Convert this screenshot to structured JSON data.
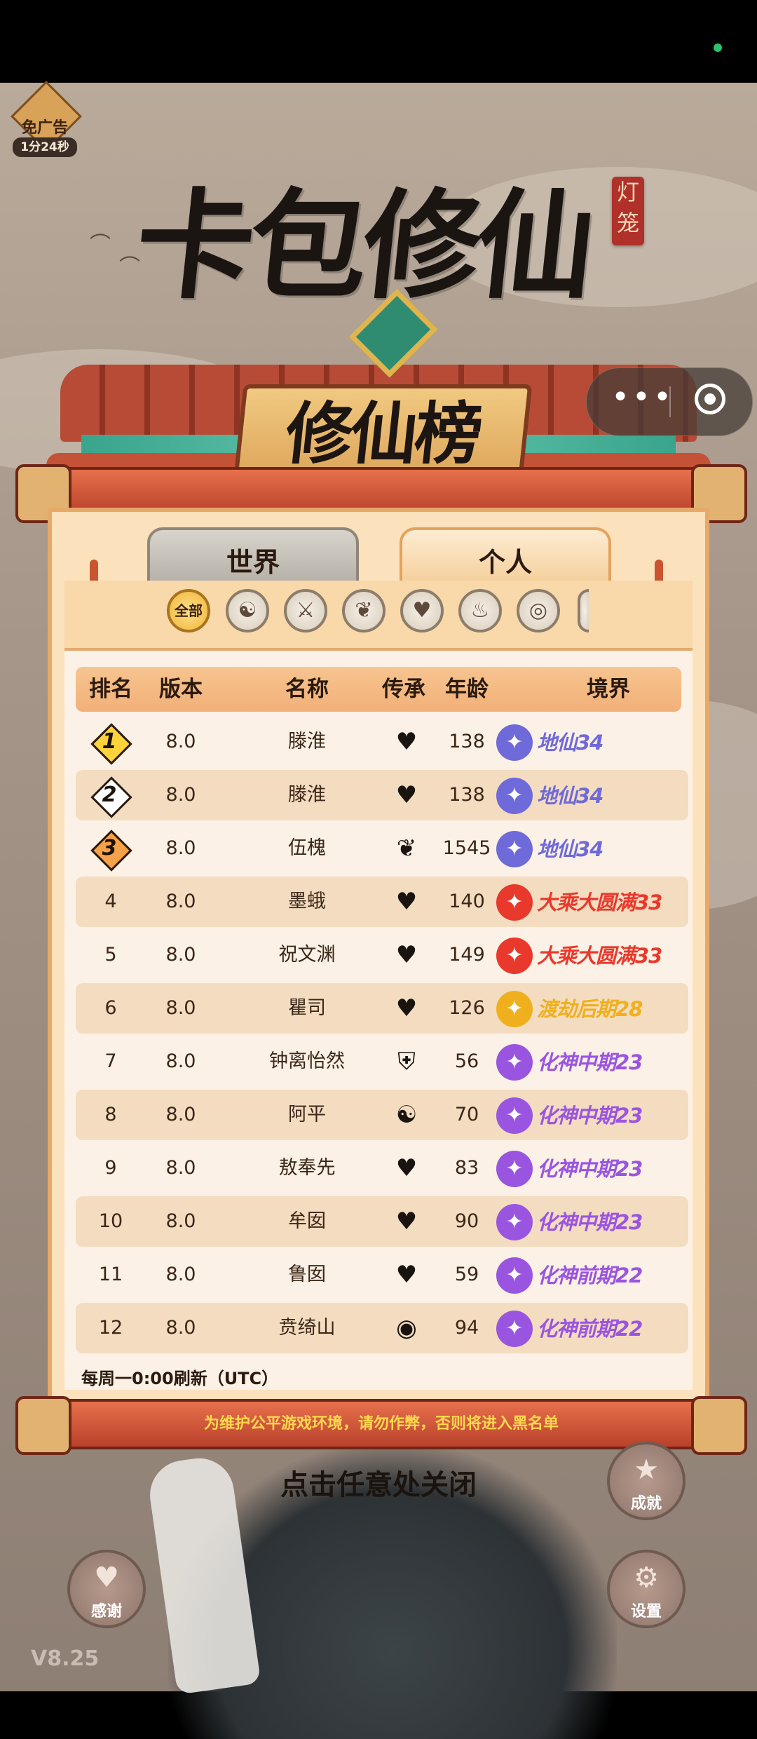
{
  "free_ad": {
    "label": "免广告",
    "timer": "1分24秒"
  },
  "seal": {
    "text": "灯笼"
  },
  "game_title": "卡包修仙",
  "board_title": "修仙榜",
  "capsule": {
    "more": "•••"
  },
  "tabs": {
    "world": "世界",
    "personal": "个人",
    "active": "personal"
  },
  "filters": [
    {
      "label": "全部",
      "active": true
    },
    {
      "icon": "yin-yang-icon"
    },
    {
      "icon": "sword-icon"
    },
    {
      "icon": "lotus-icon"
    },
    {
      "icon": "heart-icon"
    },
    {
      "icon": "flame-icon"
    },
    {
      "icon": "spiral-icon"
    }
  ],
  "table": {
    "headers": {
      "rank": "排名",
      "version": "版本",
      "name": "名称",
      "inherit": "传承",
      "age": "年龄",
      "realm": "境界"
    },
    "rows": [
      {
        "rank": "1",
        "version": "8.0",
        "name": "滕淮",
        "inherit_icon": "heart-icon",
        "age": "138",
        "realm": "地仙34",
        "realm_color": "#6f6ad9"
      },
      {
        "rank": "2",
        "version": "8.0",
        "name": "滕淮",
        "inherit_icon": "heart-icon",
        "age": "138",
        "realm": "地仙34",
        "realm_color": "#6f6ad9"
      },
      {
        "rank": "3",
        "version": "8.0",
        "name": "伍槐",
        "inherit_icon": "lotus-icon",
        "age": "1545",
        "realm": "地仙34",
        "realm_color": "#6f6ad9"
      },
      {
        "rank": "4",
        "version": "8.0",
        "name": "墨蛾",
        "inherit_icon": "heart-icon",
        "age": "140",
        "realm": "大乘大圆满33",
        "realm_color": "#e8392c"
      },
      {
        "rank": "5",
        "version": "8.0",
        "name": "祝文渊",
        "inherit_icon": "heart-icon",
        "age": "149",
        "realm": "大乘大圆满33",
        "realm_color": "#e8392c"
      },
      {
        "rank": "6",
        "version": "8.0",
        "name": "瞿司",
        "inherit_icon": "heart-icon",
        "age": "126",
        "realm": "渡劫后期28",
        "realm_color": "#f0b01e"
      },
      {
        "rank": "7",
        "version": "8.0",
        "name": "钟离怡然",
        "inherit_icon": "shield-icon",
        "age": "56",
        "realm": "化神中期23",
        "realm_color": "#9a55e0"
      },
      {
        "rank": "8",
        "version": "8.0",
        "name": "阿平",
        "inherit_icon": "yin-yang-icon",
        "age": "70",
        "realm": "化神中期23",
        "realm_color": "#9a55e0"
      },
      {
        "rank": "9",
        "version": "8.0",
        "name": "敖奉先",
        "inherit_icon": "heart-icon",
        "age": "83",
        "realm": "化神中期23",
        "realm_color": "#9a55e0"
      },
      {
        "rank": "10",
        "version": "8.0",
        "name": "牟囡",
        "inherit_icon": "heart-icon",
        "age": "90",
        "realm": "化神中期23",
        "realm_color": "#9a55e0"
      },
      {
        "rank": "11",
        "version": "8.0",
        "name": "鲁囡",
        "inherit_icon": "heart-icon",
        "age": "59",
        "realm": "化神前期22",
        "realm_color": "#9a55e0"
      },
      {
        "rank": "12",
        "version": "8.0",
        "name": "贲绮山",
        "inherit_icon": "ring-icon",
        "age": "94",
        "realm": "化神前期22",
        "realm_color": "#9a55e0"
      }
    ]
  },
  "refresh_note": "每周一0:00刷新（UTC）",
  "warning": "为维护公平游戏环境，请勿作弊，否则将进入黑名单",
  "close_hint": "点击任意处关闭",
  "buttons": {
    "achievement": "成就",
    "thanks": "感谢",
    "settings": "设置"
  },
  "version": "V8.25",
  "colors": {
    "accent": "#f2b079",
    "panel": "#fbe1bc",
    "warning": "#ffd84f"
  }
}
